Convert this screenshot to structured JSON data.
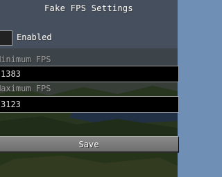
{
  "screen": {
    "title": "Fake FPS Settings"
  },
  "enabled_toggle": {
    "label": "Enabled",
    "checked": false
  },
  "min_fps": {
    "label": "Minimum FPS",
    "value": "1383"
  },
  "max_fps": {
    "label": "Maximum FPS",
    "value": "3123"
  },
  "save_button": {
    "label": "Save"
  },
  "colors": {
    "label_text": "#a0a0a0",
    "title_text": "#ffffff",
    "field_bg": "#000000",
    "field_border": "#a0a0a0",
    "button_bg": "#7a7a7a"
  },
  "background": {
    "description_icon": "landscape-background"
  }
}
